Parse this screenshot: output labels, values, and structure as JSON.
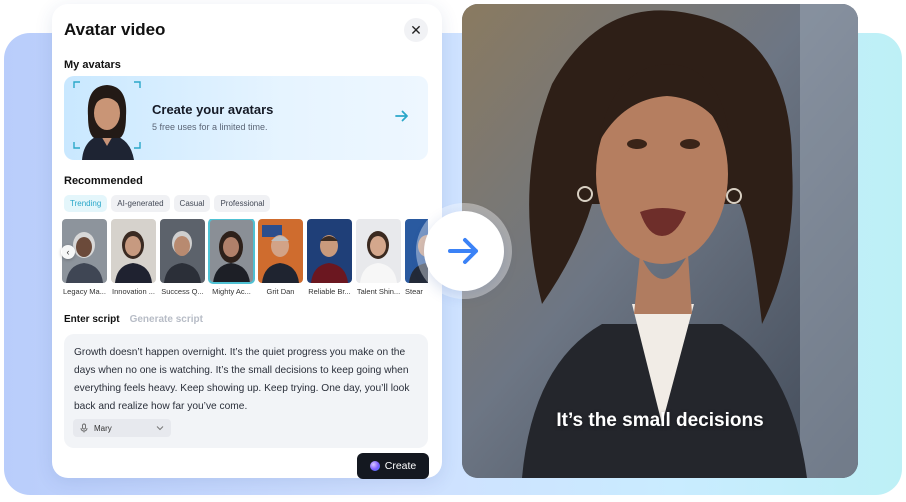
{
  "panel": {
    "title": "Avatar video",
    "close_icon": "close-icon",
    "my_avatars_label": "My avatars",
    "banner": {
      "title": "Create your avatars",
      "subtitle": "5 free uses for a limited time.",
      "arrow_icon": "arrow-right-icon"
    },
    "recommended_label": "Recommended",
    "tabs": [
      {
        "label": "Trending",
        "active": true
      },
      {
        "label": "AI-generated",
        "active": false
      },
      {
        "label": "Casual",
        "active": false
      },
      {
        "label": "Professional",
        "active": false
      }
    ],
    "avatars": [
      {
        "name": "Legacy Ma..."
      },
      {
        "name": "Innovation ..."
      },
      {
        "name": "Success Q..."
      },
      {
        "name": "Mighty Ac...",
        "selected": true
      },
      {
        "name": "Grit Dan"
      },
      {
        "name": "Reliable Br..."
      },
      {
        "name": "Talent Shin..."
      },
      {
        "name": "Stear"
      }
    ],
    "script_tabs": {
      "active": "Enter script",
      "inactive": "Generate script"
    },
    "script_text": "Growth doesn’t happen overnight. It’s the quiet progress you make on the days when no one is watching. It’s the small decisions to keep going when everything feels heavy. Keep showing up. Keep trying. One day, you’ll look back and realize how far you’ve come.",
    "voice": {
      "value": "Mary",
      "icon": "microphone-icon"
    },
    "create_label": "Create"
  },
  "video": {
    "caption": "It’s the small decisions"
  },
  "center_arrow_icon": "arrow-right-icon",
  "colors": {
    "accent": "#2aa7c9",
    "arrow_blue": "#3b82f6",
    "create_bg": "#141820"
  }
}
